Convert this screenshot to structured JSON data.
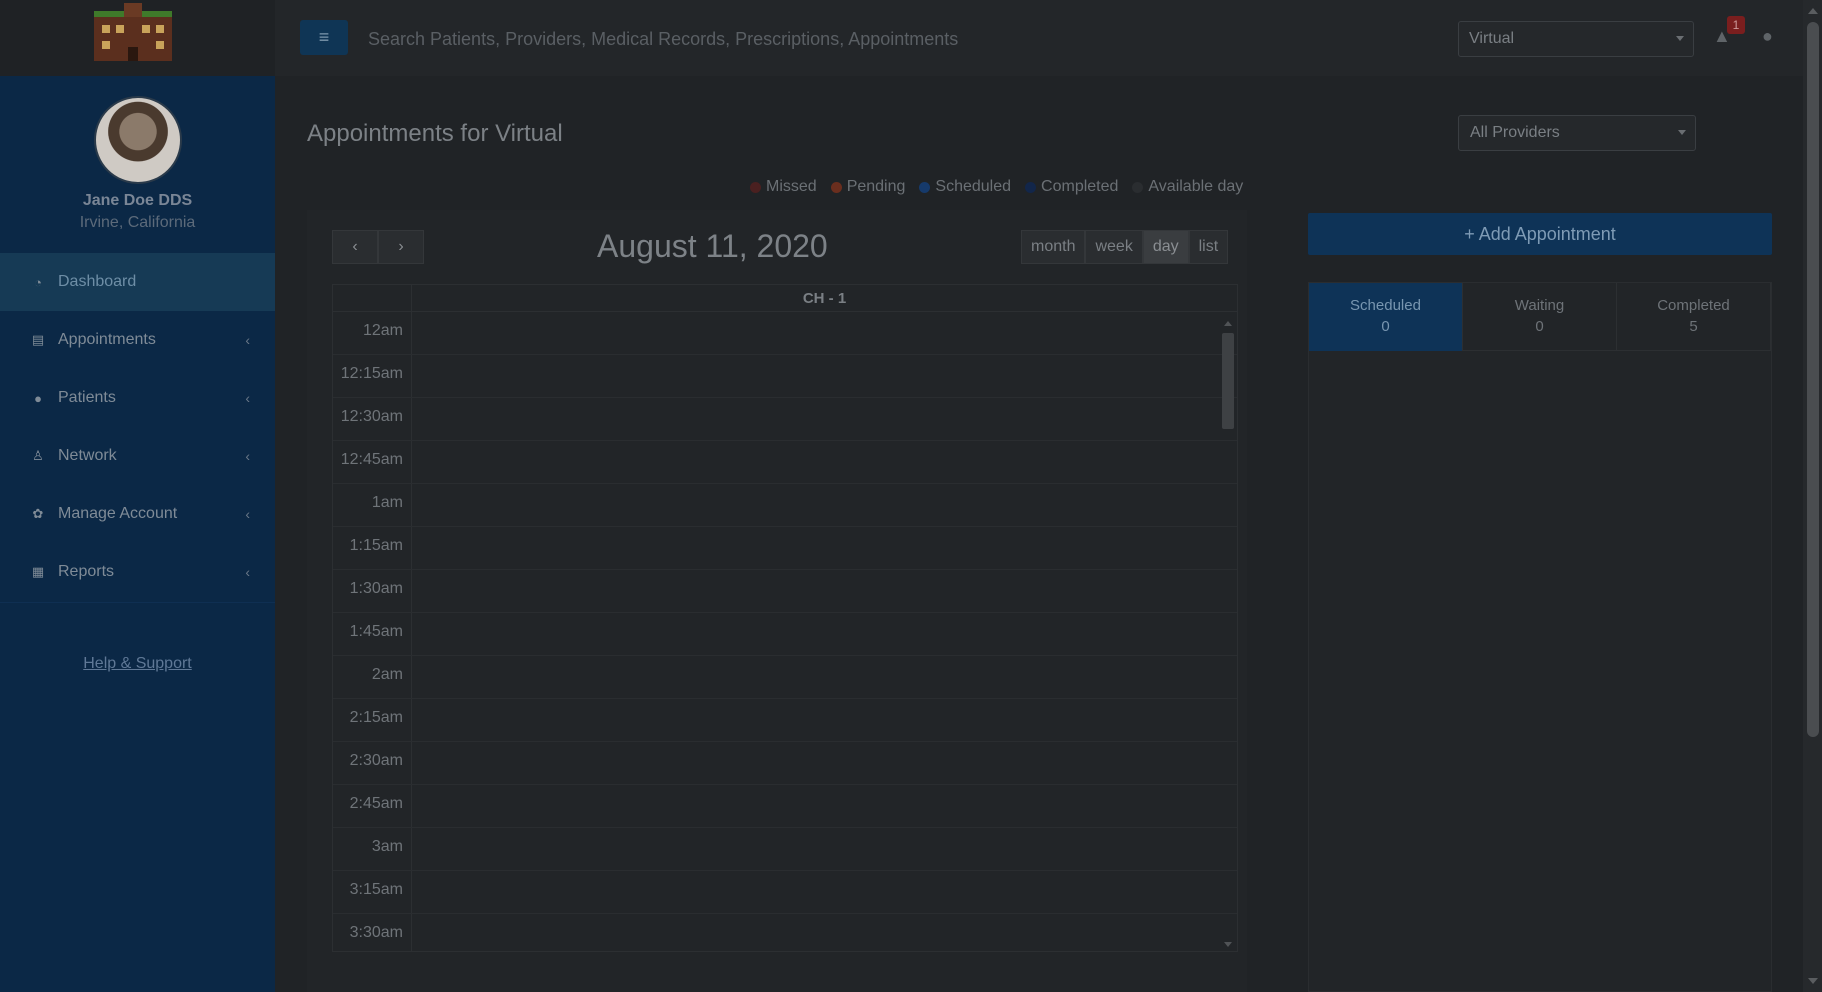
{
  "sidebar": {
    "profile": {
      "name": "Jane Doe DDS",
      "location": "Irvine, California"
    },
    "items": [
      {
        "label": "Dashboard",
        "icon": "dashboard-icon"
      },
      {
        "label": "Appointments",
        "icon": "calendar-icon"
      },
      {
        "label": "Patients",
        "icon": "users-icon"
      },
      {
        "label": "Network",
        "icon": "network-icon"
      },
      {
        "label": "Manage Account",
        "icon": "gear-icon"
      },
      {
        "label": "Reports",
        "icon": "file-icon"
      }
    ],
    "help_label": "Help & Support"
  },
  "topbar": {
    "search_placeholder": "Search Patients, Providers, Medical Records, Prescriptions, Appointments",
    "location": "Virtual",
    "notification_count": "1"
  },
  "main": {
    "title": "Appointments for Virtual",
    "provider_filter": "All Providers",
    "legend": [
      {
        "label": "Missed",
        "color": "#4a2020"
      },
      {
        "label": "Pending",
        "color": "#6a2e1e"
      },
      {
        "label": "Scheduled",
        "color": "#163a6b"
      },
      {
        "label": "Completed",
        "color": "#12264a"
      },
      {
        "label": "Available day",
        "color": "#2a2d30"
      }
    ],
    "calendar": {
      "date": "August 11, 2020",
      "views": [
        "month",
        "week",
        "day",
        "list"
      ],
      "active_view": "day",
      "resource": "CH - 1",
      "times": [
        "12am",
        "12:15am",
        "12:30am",
        "12:45am",
        "1am",
        "1:15am",
        "1:30am",
        "1:45am",
        "2am",
        "2:15am",
        "2:30am",
        "2:45am",
        "3am",
        "3:15am",
        "3:30am"
      ]
    },
    "add_button": "+ Add Appointment",
    "status_tabs": [
      {
        "label": "Scheduled",
        "count": "0"
      },
      {
        "label": "Waiting",
        "count": "0"
      },
      {
        "label": "Completed",
        "count": "5"
      }
    ]
  }
}
